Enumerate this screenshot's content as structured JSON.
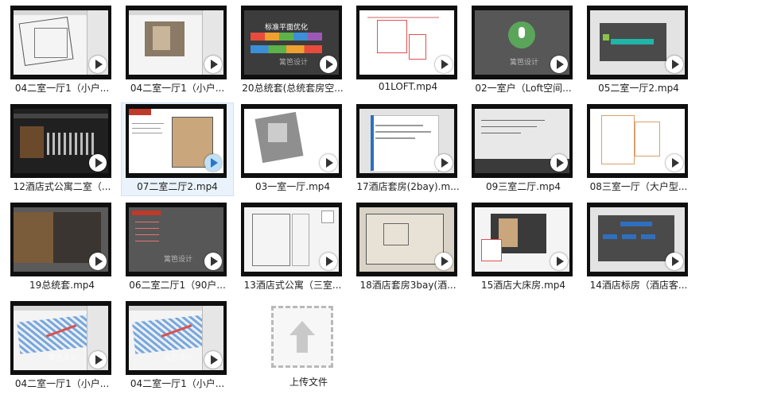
{
  "files": [
    {
      "caption": "04二室一厅1（小户...",
      "style": "cad"
    },
    {
      "caption": "04二室一厅1（小户...",
      "style": "cad-photo"
    },
    {
      "caption": "20总统套(总统套房空...",
      "style": "title-slide",
      "slide_title": "标准平面优化"
    },
    {
      "caption": "01LOFT.mp4",
      "style": "red-cad"
    },
    {
      "caption": "02一室户（Loft空间...",
      "style": "mic"
    },
    {
      "caption": "05二室一厅2.mp4",
      "style": "teal-slide"
    },
    {
      "caption": "12酒店式公寓二室（...",
      "style": "room"
    },
    {
      "caption": "07二室二厅2.mp4",
      "style": "plan-slide",
      "selected": true
    },
    {
      "caption": "03一室一厅.mp4",
      "style": "grey-plan"
    },
    {
      "caption": "17酒店套房(2bay).m...",
      "style": "word"
    },
    {
      "caption": "09三室二厅.mp4",
      "style": "text-slide"
    },
    {
      "caption": "08三室一厅（大户型...",
      "style": "plan-white"
    },
    {
      "caption": "19总统套.mp4",
      "style": "room-photo"
    },
    {
      "caption": "06二室二厅1（90户...",
      "style": "list-slide"
    },
    {
      "caption": "13酒店式公寓（三室...",
      "style": "cad-white"
    },
    {
      "caption": "18酒店套房3bay(酒...",
      "style": "beige-plan"
    },
    {
      "caption": "15酒店大床房.mp4",
      "style": "room-cad"
    },
    {
      "caption": "14酒店标房（酒店客...",
      "style": "menu-slide"
    },
    {
      "caption": "04二室一厅1（小户...",
      "style": "blue-cad"
    },
    {
      "caption": "04二室一厅1（小户...",
      "style": "blue-cad"
    }
  ],
  "watermark": "篱笆设计",
  "upload": {
    "label": "上传文件"
  }
}
